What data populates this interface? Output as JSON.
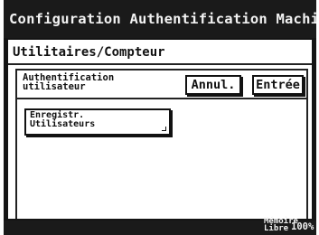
{
  "window": {
    "title": "Configuration Authentification Machine"
  },
  "breadcrumb": "Utilitaires/Compteur",
  "panel": {
    "title_line1": "Authentification",
    "title_line2": "utilisateur",
    "cancel_label": "Annul.",
    "enter_label": "Entrée",
    "register_line1": "Enregistr.",
    "register_line2": "Utilisateurs"
  },
  "status": {
    "memory_label": "Mémoire",
    "memory_sub": "Libre",
    "memory_value": "100%"
  }
}
